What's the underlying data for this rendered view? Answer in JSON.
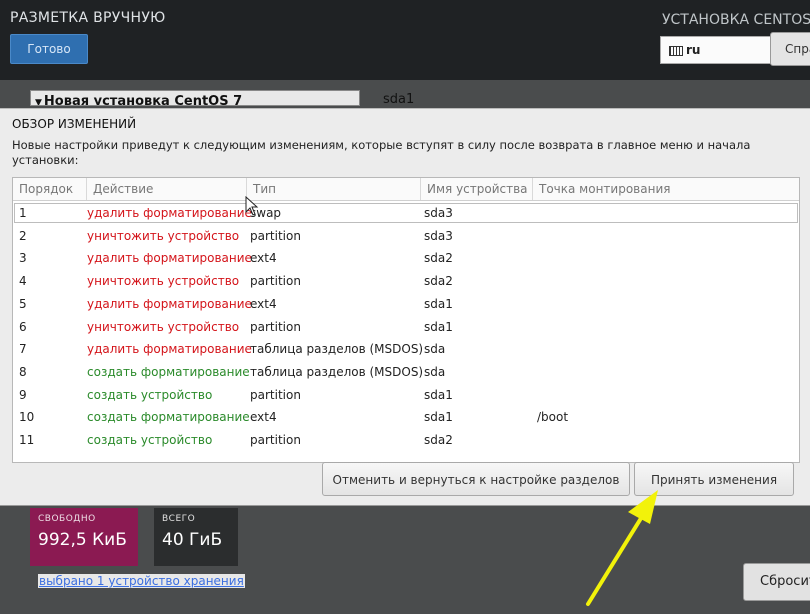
{
  "background": {
    "title": "РАЗМЕТКА ВРУЧНУЮ",
    "done_button": "Готово",
    "right_title": "УСТАНОВКА CENTOS",
    "language": "ru",
    "help_button": "Справка",
    "tree_header": "Новая установка CentOS 7",
    "device_label": "sda1",
    "free_label": "СВОБОДНО",
    "free_value": "992,5 КиБ",
    "total_label": "ВСЕГО",
    "total_value": "40 ГиБ",
    "storage_link": "выбрано 1 устройство хранения",
    "reset_button": "Сбросить"
  },
  "dialog": {
    "title": "ОБЗОР ИЗМЕНЕНИЙ",
    "description": "Новые настройки приведут к следующим изменениям, которые вступят в силу после возврата в главное меню и начала установки:",
    "columns": [
      "Порядок",
      "Действие",
      "Тип",
      "Имя устройства",
      "Точка монтирования"
    ],
    "rows": [
      {
        "order": "1",
        "action": "удалить форматирование",
        "kind": "destroy",
        "type": "swap",
        "device": "sda3",
        "mount": ""
      },
      {
        "order": "2",
        "action": "уничтожить устройство",
        "kind": "destroy",
        "type": "partition",
        "device": "sda3",
        "mount": ""
      },
      {
        "order": "3",
        "action": "удалить форматирование",
        "kind": "destroy",
        "type": "ext4",
        "device": "sda2",
        "mount": ""
      },
      {
        "order": "4",
        "action": "уничтожить устройство",
        "kind": "destroy",
        "type": "partition",
        "device": "sda2",
        "mount": ""
      },
      {
        "order": "5",
        "action": "удалить форматирование",
        "kind": "destroy",
        "type": "ext4",
        "device": "sda1",
        "mount": ""
      },
      {
        "order": "6",
        "action": "уничтожить устройство",
        "kind": "destroy",
        "type": "partition",
        "device": "sda1",
        "mount": ""
      },
      {
        "order": "7",
        "action": "удалить форматирование",
        "kind": "destroy",
        "type": "таблица разделов (MSDOS)",
        "device": "sda",
        "mount": ""
      },
      {
        "order": "8",
        "action": "создать форматирование",
        "kind": "create",
        "type": "таблица разделов (MSDOS)",
        "device": "sda",
        "mount": ""
      },
      {
        "order": "9",
        "action": "создать устройство",
        "kind": "create",
        "type": "partition",
        "device": "sda1",
        "mount": ""
      },
      {
        "order": "10",
        "action": "создать форматирование",
        "kind": "create",
        "type": "ext4",
        "device": "sda1",
        "mount": "/boot"
      },
      {
        "order": "11",
        "action": "создать устройство",
        "kind": "create",
        "type": "partition",
        "device": "sda2",
        "mount": ""
      }
    ],
    "cancel_button": "Отменить и вернуться к настройке разделов",
    "accept_button": "Принять изменения"
  },
  "colors": {
    "destroy": "#d4141a",
    "create": "#2a8a2a",
    "annotation_arrow": "#f2f20a"
  }
}
